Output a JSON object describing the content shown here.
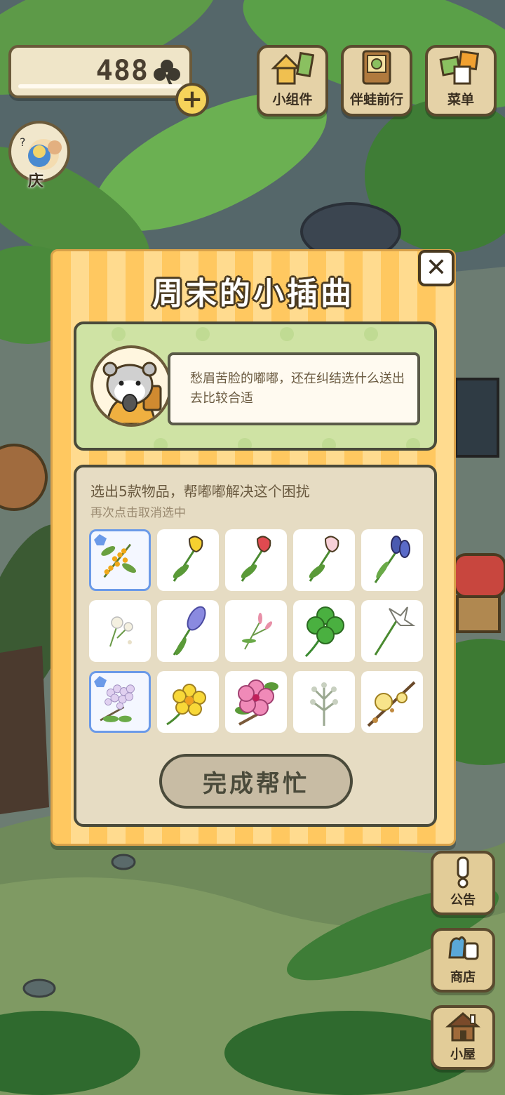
{
  "currency": {
    "amount": "488",
    "icon": "clover-icon",
    "add_label": "+"
  },
  "avatar": {
    "badge_label": "庆"
  },
  "top_buttons": [
    {
      "label": "小组件",
      "icon": "widget-icon"
    },
    {
      "label": "伴蛙前行",
      "icon": "frog-book-icon"
    },
    {
      "label": "菜单",
      "icon": "menu-icon"
    }
  ],
  "side_buttons": [
    {
      "label": "公告",
      "icon": "exclamation-icon"
    },
    {
      "label": "商店",
      "icon": "shop-bag-icon"
    },
    {
      "label": "小屋",
      "icon": "house-icon"
    }
  ],
  "dialog": {
    "title": "周末的小插曲",
    "close_label": "✕",
    "story_text": "愁眉苦脸的嘟嘟，还在纠结选什么送出去比较合适",
    "instruction": "选出5款物品，帮嘟嘟解决这个困扰",
    "sub_instruction": "再次点击取消选中",
    "done_label": "完成帮忙",
    "items": [
      {
        "icon": "osmanthus-icon",
        "selected": true
      },
      {
        "icon": "yellow-tulip-icon",
        "selected": false
      },
      {
        "icon": "red-tulip-icon",
        "selected": false
      },
      {
        "icon": "pink-tulip-icon",
        "selected": false
      },
      {
        "icon": "iris-icon",
        "selected": false
      },
      {
        "icon": "dandelion-icon",
        "selected": false
      },
      {
        "icon": "hyacinth-icon",
        "selected": false
      },
      {
        "icon": "pink-sprig-icon",
        "selected": false
      },
      {
        "icon": "four-leaf-clover-icon",
        "selected": false
      },
      {
        "icon": "white-lily-icon",
        "selected": false
      },
      {
        "icon": "lilac-icon",
        "selected": true
      },
      {
        "icon": "buttercup-icon",
        "selected": false
      },
      {
        "icon": "hibiscus-icon",
        "selected": false
      },
      {
        "icon": "silver-herb-icon",
        "selected": false
      },
      {
        "icon": "wintersweet-icon",
        "selected": false
      }
    ]
  }
}
